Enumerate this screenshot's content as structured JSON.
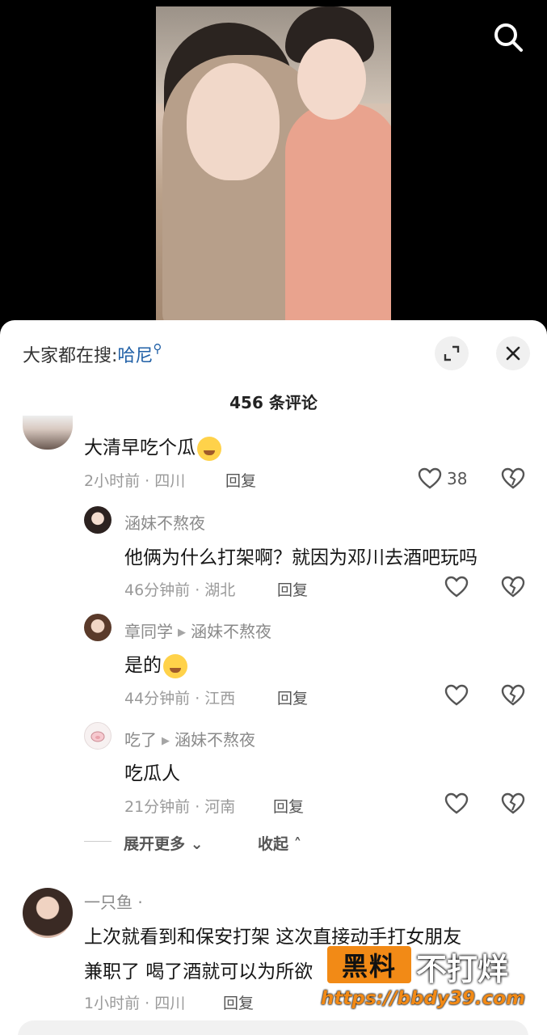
{
  "hot_search": {
    "prefix": "大家都在搜:",
    "keyword": "哈尼"
  },
  "comment_count": "456 条评论",
  "comments": [
    {
      "text": "大清早吃个瓜",
      "time_location": "2小时前 · 四川",
      "reply": "回复",
      "likes": "38"
    },
    {
      "name": "涵妹不熬夜",
      "text": "他俩为什么打架啊？就因为邓川去酒吧玩吗",
      "time_location": "46分钟前 · 湖北",
      "reply": "回复"
    },
    {
      "name": "章同学",
      "reply_to": "涵妹不熬夜",
      "text": "是的",
      "time_location": "44分钟前 · 江西",
      "reply": "回复"
    },
    {
      "name": "吃了",
      "reply_to": "涵妹不熬夜",
      "text": "吃瓜人",
      "time_location": "21分钟前 · 河南",
      "reply": "回复"
    },
    {
      "name": "一只鱼 ·",
      "text_line1": "上次就看到和保安打架 这次直接动手打女朋友",
      "text_line2": "兼职了 喝了酒就可以为所欲",
      "time_location": "1小时前 · 四川",
      "reply": "回复"
    }
  ],
  "expand_more": "展开更多",
  "collapse": "收起",
  "watermark": {
    "box": "黑料",
    "rest": "不打烊",
    "url": "https://bbdy39.com"
  },
  "colors": {
    "keyword": "#1f5fa6",
    "watermark_orange": "#f28a16"
  }
}
